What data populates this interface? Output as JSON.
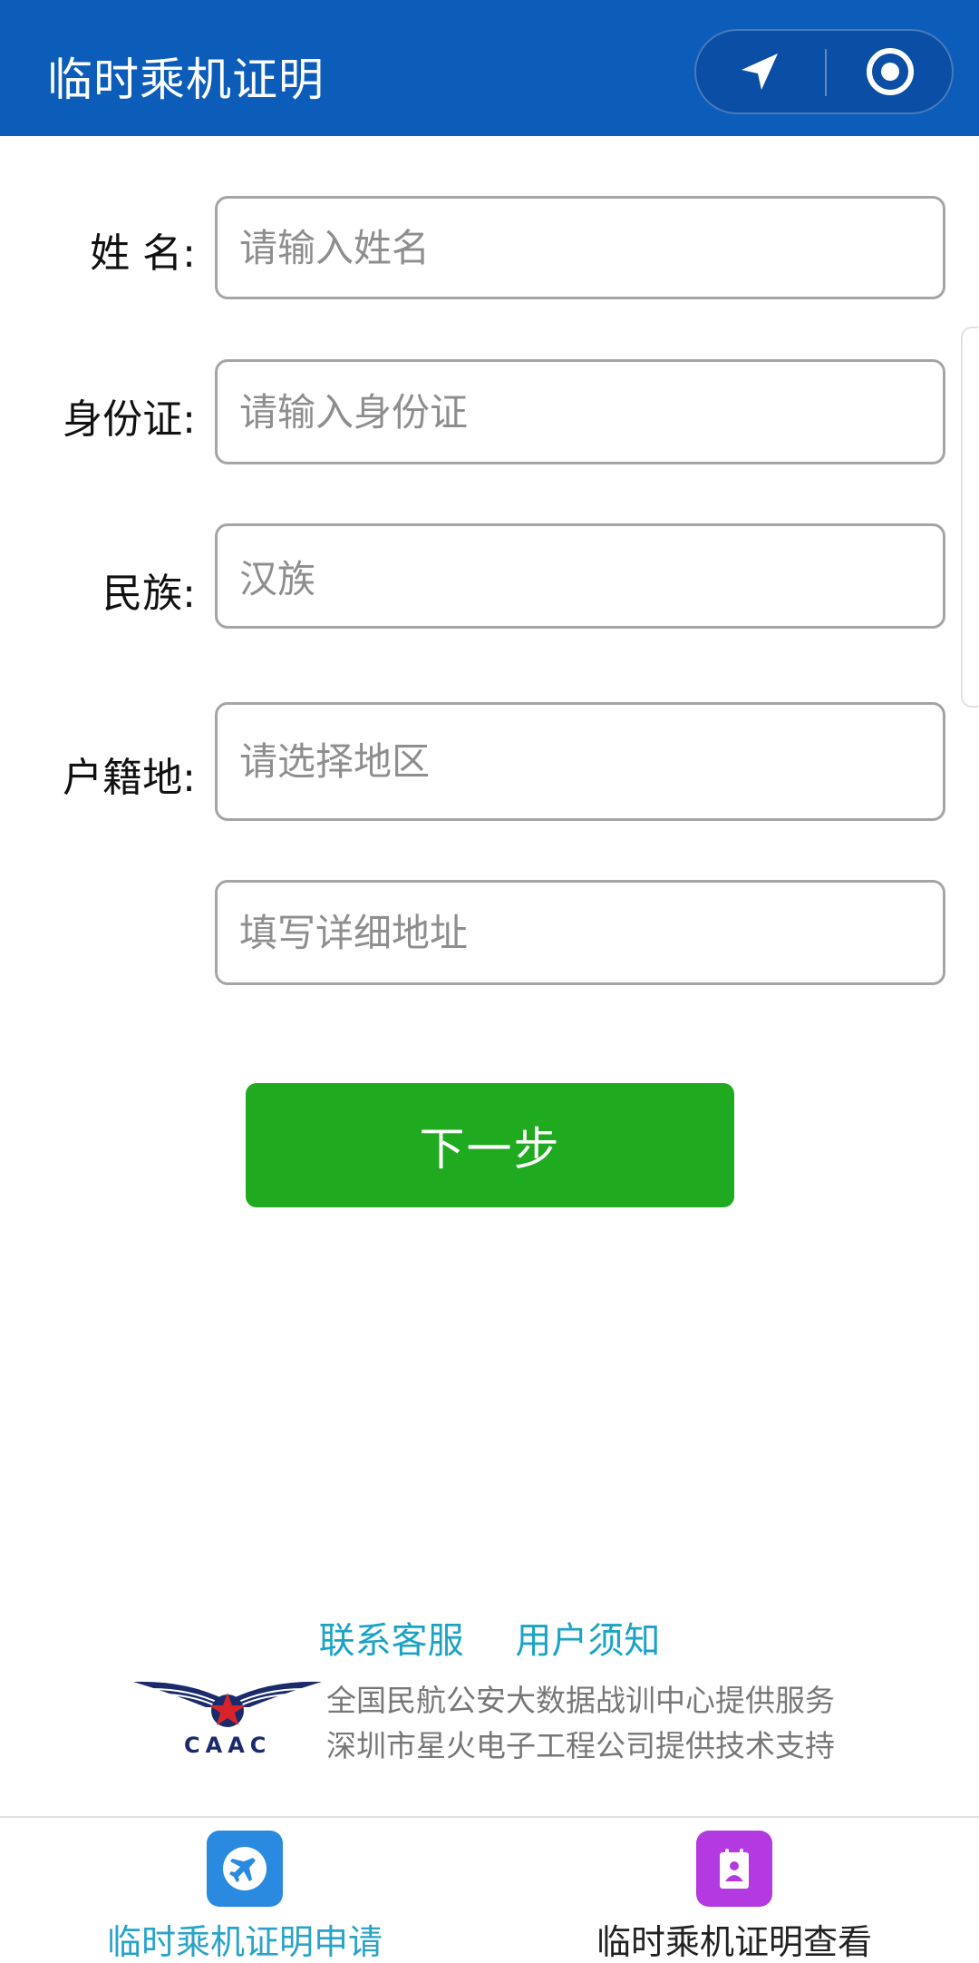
{
  "header": {
    "title": "临时乘机证明",
    "capsule": {
      "left_icon": "navigation-arrow-icon",
      "right_icon": "record-target-icon"
    },
    "bg_color": "#0c5cba"
  },
  "form": {
    "name": {
      "label": "姓 名:",
      "placeholder": "请输入姓名"
    },
    "id_card": {
      "label": "身份证:",
      "placeholder": "请输入身份证"
    },
    "ethnicity": {
      "label": "民族:",
      "value": "汉族"
    },
    "origin": {
      "label": "户籍地:",
      "placeholder": "请选择地区"
    },
    "address": {
      "placeholder": "填写详细地址"
    },
    "next_label": "下一步",
    "next_color": "#1faa1f"
  },
  "footer": {
    "links": [
      "联系客服",
      "用户须知"
    ],
    "logo_text": "CAAC",
    "provider_lines": [
      "全国民航公安大数据战训中心提供服务",
      "深圳市星火电子工程公司提供技术支持"
    ]
  },
  "tabbar": {
    "tabs": [
      {
        "label": "临时乘机证明申请",
        "icon": "airplane-icon",
        "active": true
      },
      {
        "label": "临时乘机证明查看",
        "icon": "id-card-icon",
        "active": false
      }
    ]
  }
}
